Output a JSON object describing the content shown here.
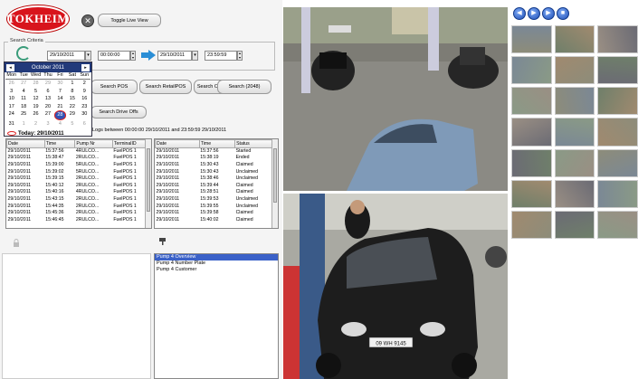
{
  "app": {
    "logo_text": "TOKHEIM"
  },
  "toolbar": {
    "close_symbol": "✕",
    "toggle_live_view": "Toggle Live View"
  },
  "search": {
    "group_label": "Search Criteria",
    "from_date": "29/10/2011",
    "from_time": "00:00:00",
    "to_date": "29/10/2011",
    "to_time": "23:59:59",
    "tabs": [
      "Search POS",
      "Search RetailPOS",
      "Search OperatorPOS",
      "Search (2048)"
    ],
    "drive_off_button": "Search Drive Offs",
    "range_text": "Logs between 00:00:00 29/10/2011 and 23:59:59 29/10/2011"
  },
  "calendar": {
    "month_label": "October 2011",
    "prev": "◂",
    "next": "▸",
    "dow": [
      "Mon",
      "Tue",
      "Wed",
      "Thu",
      "Fri",
      "Sat",
      "Sun"
    ],
    "weeks": [
      [
        "26",
        "27",
        "28",
        "29",
        "30",
        "1",
        "2"
      ],
      [
        "3",
        "4",
        "5",
        "6",
        "7",
        "8",
        "9"
      ],
      [
        "10",
        "11",
        "12",
        "13",
        "14",
        "15",
        "16"
      ],
      [
        "17",
        "18",
        "19",
        "20",
        "21",
        "22",
        "23"
      ],
      [
        "24",
        "25",
        "26",
        "27",
        "28",
        "29",
        "30"
      ],
      [
        "31",
        "1",
        "2",
        "3",
        "4",
        "5",
        "6"
      ]
    ],
    "selected_day": "28",
    "today_label": "Today: 29/10/2011"
  },
  "left_table": {
    "headers": [
      "Date",
      "Time",
      "Pump Nr",
      "TerminalID"
    ],
    "rows": [
      [
        "29/10/2011",
        "15:37:56",
        "4RULCO...",
        "FuelPOS 1"
      ],
      [
        "29/10/2011",
        "15:38:47",
        "2RULCO...",
        "FuelPOS 1"
      ],
      [
        "29/10/2011",
        "15:39:00",
        "5RULCO...",
        "FuelPOS 1"
      ],
      [
        "29/10/2011",
        "15:39:02",
        "5RULCO...",
        "FuelPOS 1"
      ],
      [
        "29/10/2011",
        "15:39:15",
        "2RULCO...",
        "FuelPOS 1"
      ],
      [
        "29/10/2011",
        "15:40:12",
        "2RULCO...",
        "FuelPOS 1"
      ],
      [
        "29/10/2011",
        "15:40:16",
        "4RULCO...",
        "FuelPOS 1"
      ],
      [
        "29/10/2011",
        "15:43:15",
        "2RULCO...",
        "FuelPOS 1"
      ],
      [
        "29/10/2011",
        "15:44:35",
        "2RULCO...",
        "FuelPOS 1"
      ],
      [
        "29/10/2011",
        "15:45:36",
        "2RULCO...",
        "FuelPOS 1"
      ],
      [
        "29/10/2011",
        "15:46:45",
        "2RULCO...",
        "FuelPOS 1"
      ]
    ]
  },
  "right_table": {
    "headers": [
      "Date",
      "Time",
      "Status"
    ],
    "rows": [
      [
        "29/10/2011",
        "15:37:56",
        "Started"
      ],
      [
        "29/10/2011",
        "15:38:19",
        "Ended"
      ],
      [
        "29/10/2011",
        "15:30:43",
        "Claimed"
      ],
      [
        "29/10/2011",
        "15:30:43",
        "Unclaimed"
      ],
      [
        "29/10/2011",
        "15:38:46",
        "Unclaimed"
      ],
      [
        "29/10/2011",
        "15:39:44",
        "Claimed"
      ],
      [
        "29/10/2011",
        "15:28:51",
        "Claimed"
      ],
      [
        "29/10/2011",
        "15:39:53",
        "Unclaimed"
      ],
      [
        "29/10/2011",
        "15:39:55",
        "Unclaimed"
      ],
      [
        "29/10/2011",
        "15:39:58",
        "Claimed"
      ],
      [
        "29/10/2011",
        "15:40:02",
        "Claimed"
      ]
    ]
  },
  "event_list": {
    "items": [
      "Pump 4 Overview",
      "Pump 4 Number Plate",
      "Pump 4 Customer"
    ],
    "selected_index": 0
  },
  "camera": {
    "controls": [
      "◀",
      "▶",
      "▶",
      "■"
    ],
    "plate_text": "09 WH 9145",
    "thumbnail_count": 21
  },
  "colors": {
    "accent": "#223a7a",
    "selection": "#3a61c8",
    "logo": "#d8141c"
  }
}
